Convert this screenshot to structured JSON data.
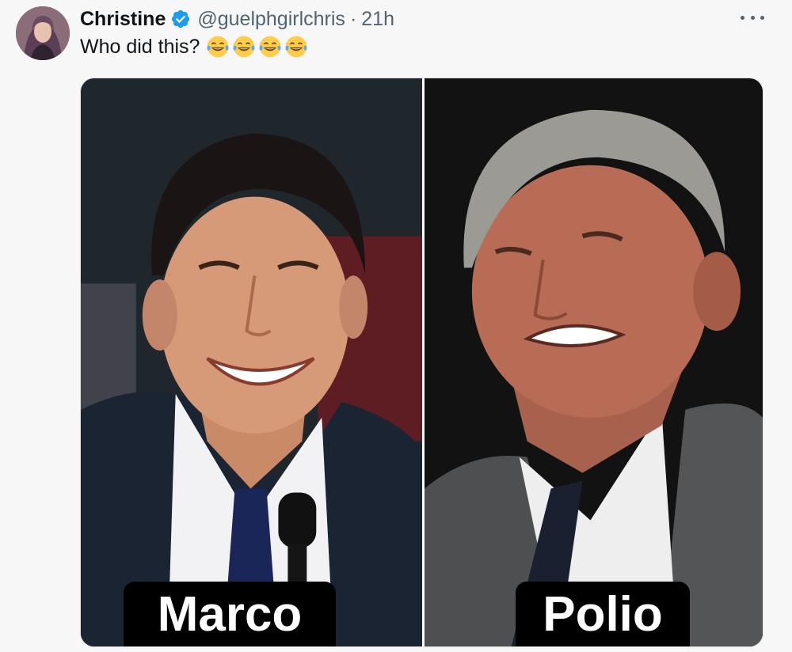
{
  "tweet": {
    "author": {
      "display_name": "Christine",
      "handle": "@guelphgirlchris",
      "separator": "·",
      "time": "21h",
      "verified": true,
      "avatar_icon": "profile-photo"
    },
    "text": "Who did this?",
    "emojis": [
      "😂",
      "😂",
      "😂",
      "😂"
    ],
    "more_icon": "more-horizontal-icon",
    "media": {
      "panels": [
        {
          "caption": "Marco"
        },
        {
          "caption": "Polio"
        }
      ]
    }
  },
  "colors": {
    "background": "#f7f7f7",
    "primary_text": "#0f1419",
    "secondary_text": "#536471",
    "verified_blue": "#1d9bf0"
  }
}
